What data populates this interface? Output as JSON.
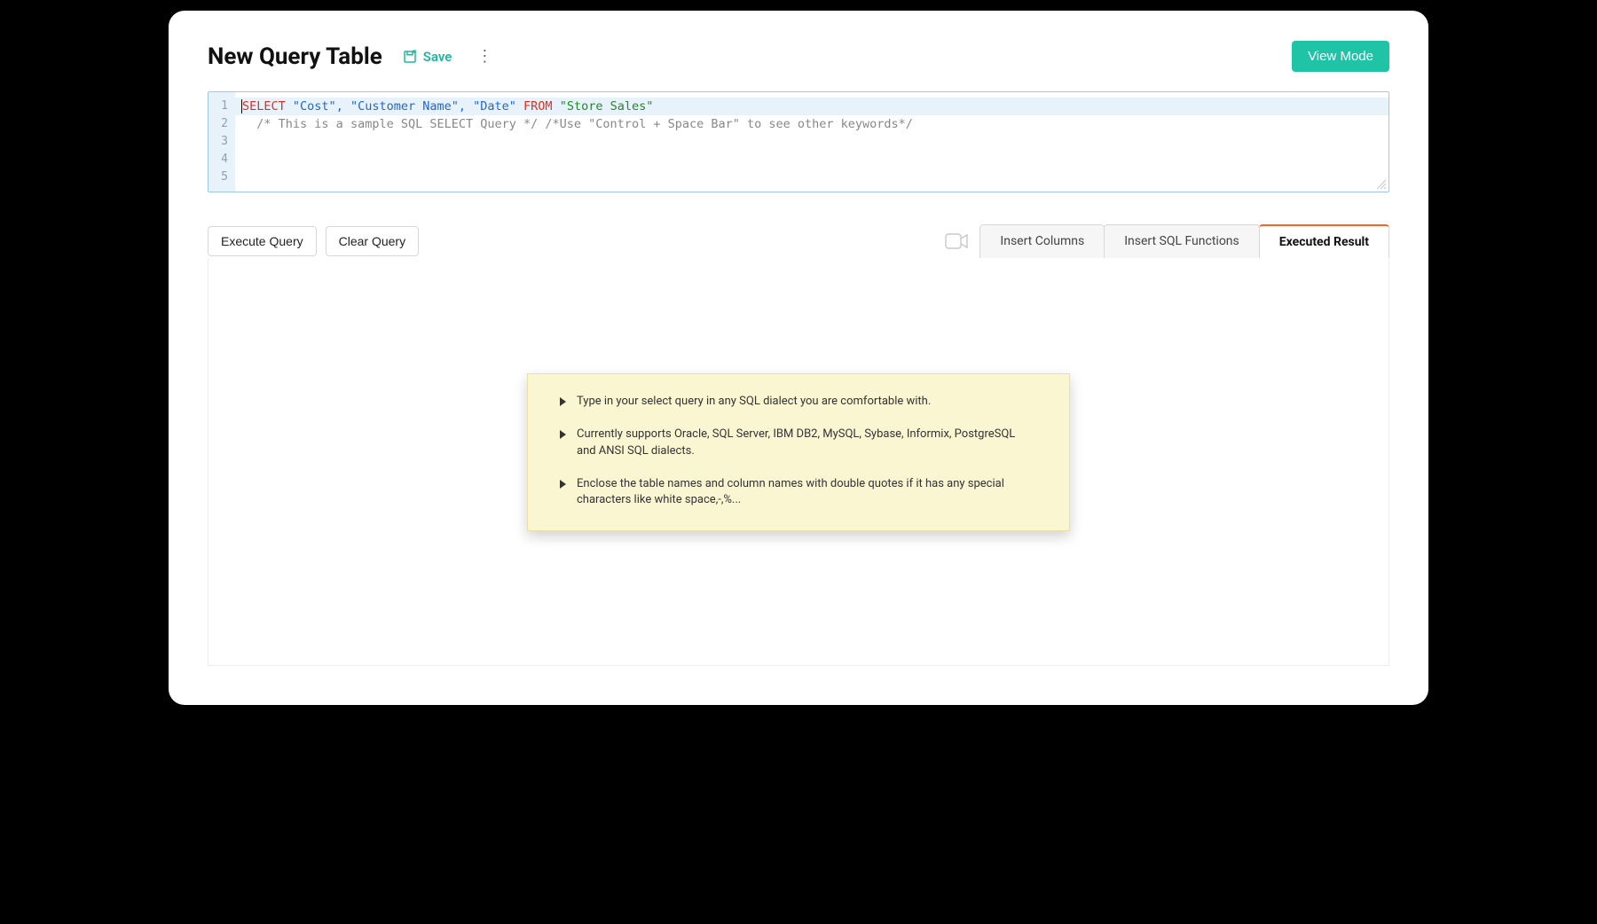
{
  "header": {
    "title": "New Query Table",
    "save_label": "Save",
    "view_mode_label": "View Mode"
  },
  "editor": {
    "lines": [
      "1",
      "2",
      "3",
      "4",
      "5"
    ],
    "sql": {
      "select_kw": "SELECT",
      "columns": "\"Cost\", \"Customer Name\", \"Date\"",
      "from_kw": "FROM",
      "table": "\"Store Sales\""
    },
    "comment1": "/* This is a sample SQL SELECT Query */",
    "comment2": "/*Use \"Control + Space Bar\" to see other keywords*/"
  },
  "toolbar": {
    "execute_label": "Execute Query",
    "clear_label": "Clear Query"
  },
  "tabs": {
    "insert_columns": "Insert Columns",
    "insert_functions": "Insert SQL Functions",
    "executed_result": "Executed Result"
  },
  "tips": {
    "items": [
      "Type in your select query in any SQL dialect you are comfortable with.",
      "Currently supports Oracle, SQL Server, IBM DB2, MySQL, Sybase, Informix, PostgreSQL and ANSI SQL dialects.",
      "Enclose the table names and column names with double quotes if it has any special characters like white space,-,%..."
    ]
  }
}
